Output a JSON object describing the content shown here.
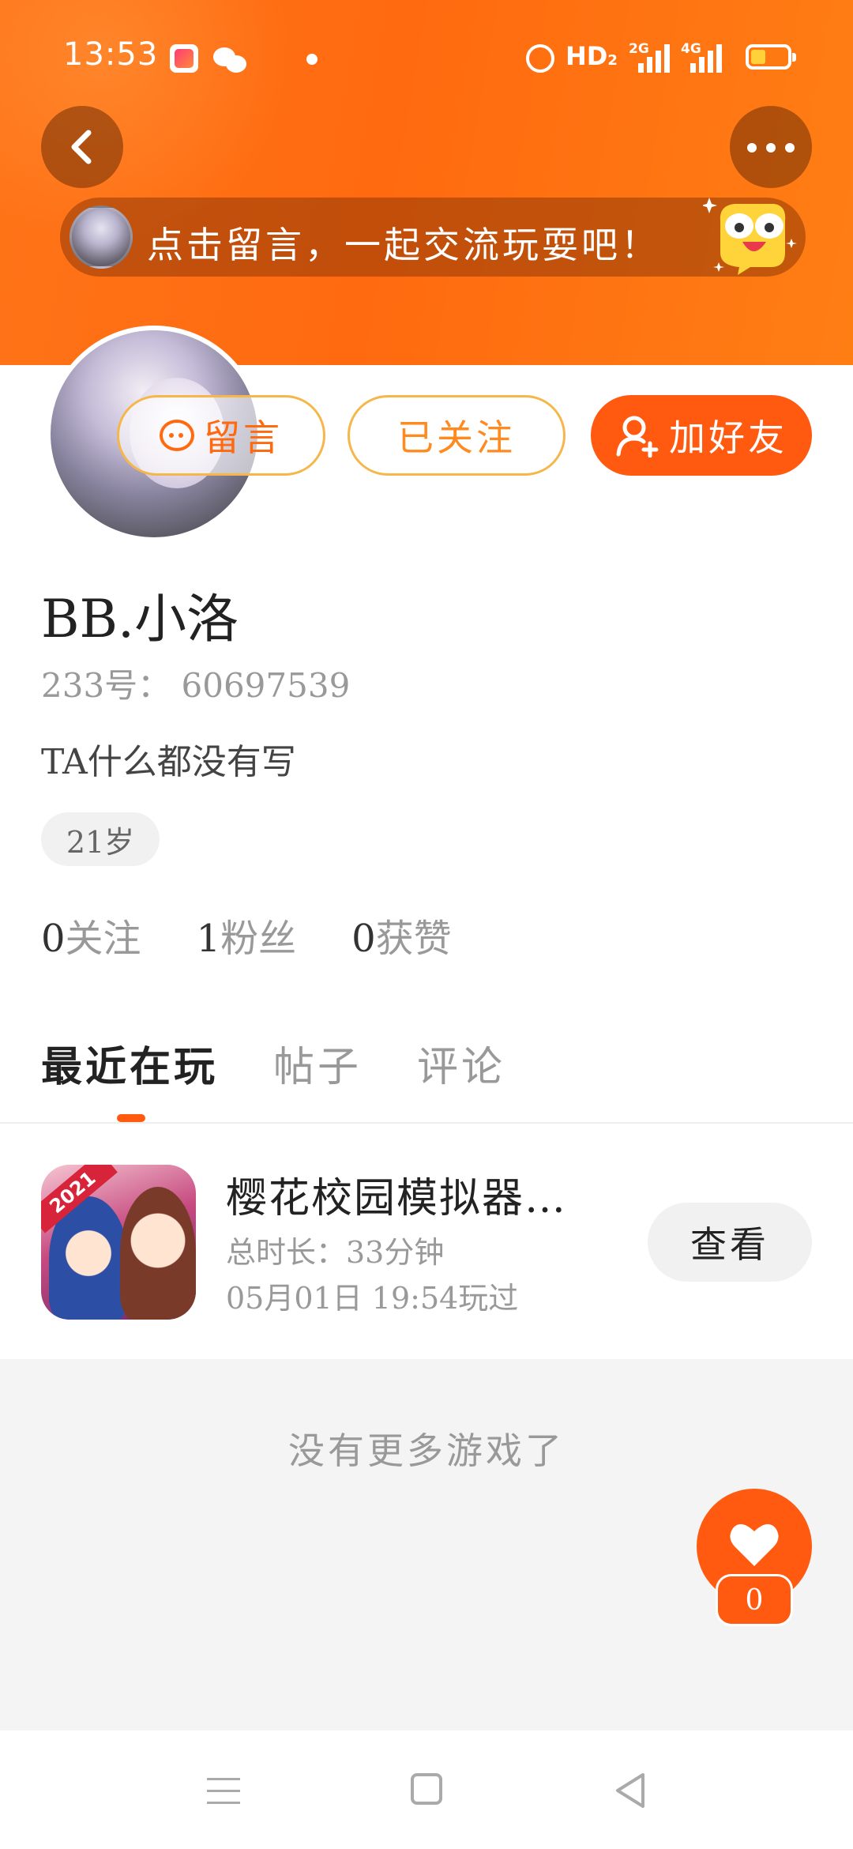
{
  "status_bar": {
    "time": "13:53",
    "network_label": "HD",
    "network_sub": "2",
    "signal1_label": "2G",
    "signal2_label": "4G",
    "icons": [
      "app-icon",
      "wechat-icon",
      "dot-icon",
      "alarm-icon",
      "signal-icon",
      "battery-icon"
    ]
  },
  "header": {
    "back_icon": "chevron-left-icon",
    "more_icon": "more-dots-icon",
    "banner_text": "点击留言，一起交流玩耍吧！"
  },
  "profile": {
    "actions": {
      "comment_label": "留言",
      "followed_label": "已关注",
      "add_friend_label": "加好友"
    },
    "name": "BB.小洛",
    "uid": "233号：  60697539",
    "bio": "TA什么都没有写",
    "age": "21岁",
    "stats": [
      {
        "num": "0",
        "label": "关注"
      },
      {
        "num": "1",
        "label": "粉丝"
      },
      {
        "num": "0",
        "label": "获赞"
      }
    ]
  },
  "tabs": [
    {
      "label": "最近在玩",
      "active": true
    },
    {
      "label": "帖子",
      "active": false
    },
    {
      "label": "评论",
      "active": false
    }
  ],
  "recent_games": [
    {
      "icon_badge": "2021",
      "title": "樱花校园模拟器…",
      "duration": "总时长：33分钟",
      "last_played": "05月01日  19:54玩过",
      "view_label": "查看"
    }
  ],
  "list_end_text": "没有更多游戏了",
  "like_fab": {
    "count": "0"
  },
  "accent_color": "#ff5a10"
}
